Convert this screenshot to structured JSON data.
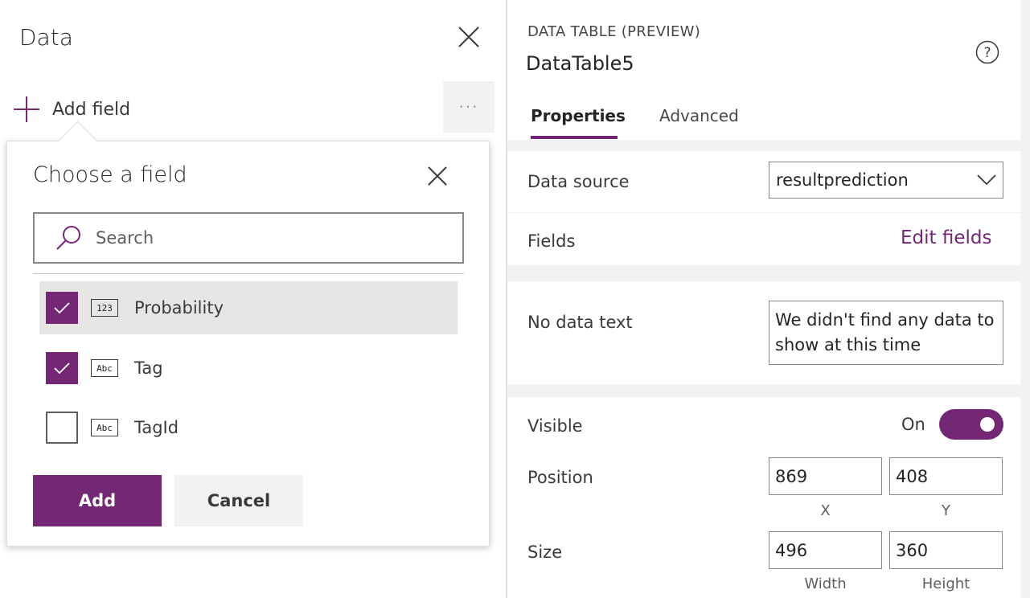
{
  "left_panel": {
    "title": "Data",
    "add_field_label": "Add field",
    "more_label": "···"
  },
  "popup": {
    "title": "Choose a field",
    "search_placeholder": "Search",
    "fields": [
      {
        "label": "Probability",
        "type_icon": "123",
        "checked": true,
        "highlighted": true
      },
      {
        "label": "Tag",
        "type_icon": "Abc",
        "checked": true,
        "highlighted": false
      },
      {
        "label": "TagId",
        "type_icon": "Abc",
        "checked": false,
        "highlighted": false
      }
    ],
    "add_label": "Add",
    "cancel_label": "Cancel"
  },
  "properties_panel": {
    "control_type": "DATA TABLE (PREVIEW)",
    "control_name": "DataTable5",
    "tabs": [
      {
        "label": "Properties",
        "active": true
      },
      {
        "label": "Advanced",
        "active": false
      }
    ],
    "data_source": {
      "label": "Data source",
      "value": "resultprediction"
    },
    "fields": {
      "label": "Fields",
      "link": "Edit fields"
    },
    "no_data_text": {
      "label": "No data text",
      "value": "We didn't find any data to show at this time"
    },
    "visible": {
      "label": "Visible",
      "state": "On",
      "enabled": true
    },
    "position": {
      "label": "Position",
      "x": "869",
      "y": "408",
      "x_label": "X",
      "y_label": "Y"
    },
    "size": {
      "label": "Size",
      "width": "496",
      "height": "360",
      "width_label": "Width",
      "height_label": "Height"
    }
  },
  "colors": {
    "accent": "#742774",
    "panel_bg": "#f3f2f1"
  }
}
